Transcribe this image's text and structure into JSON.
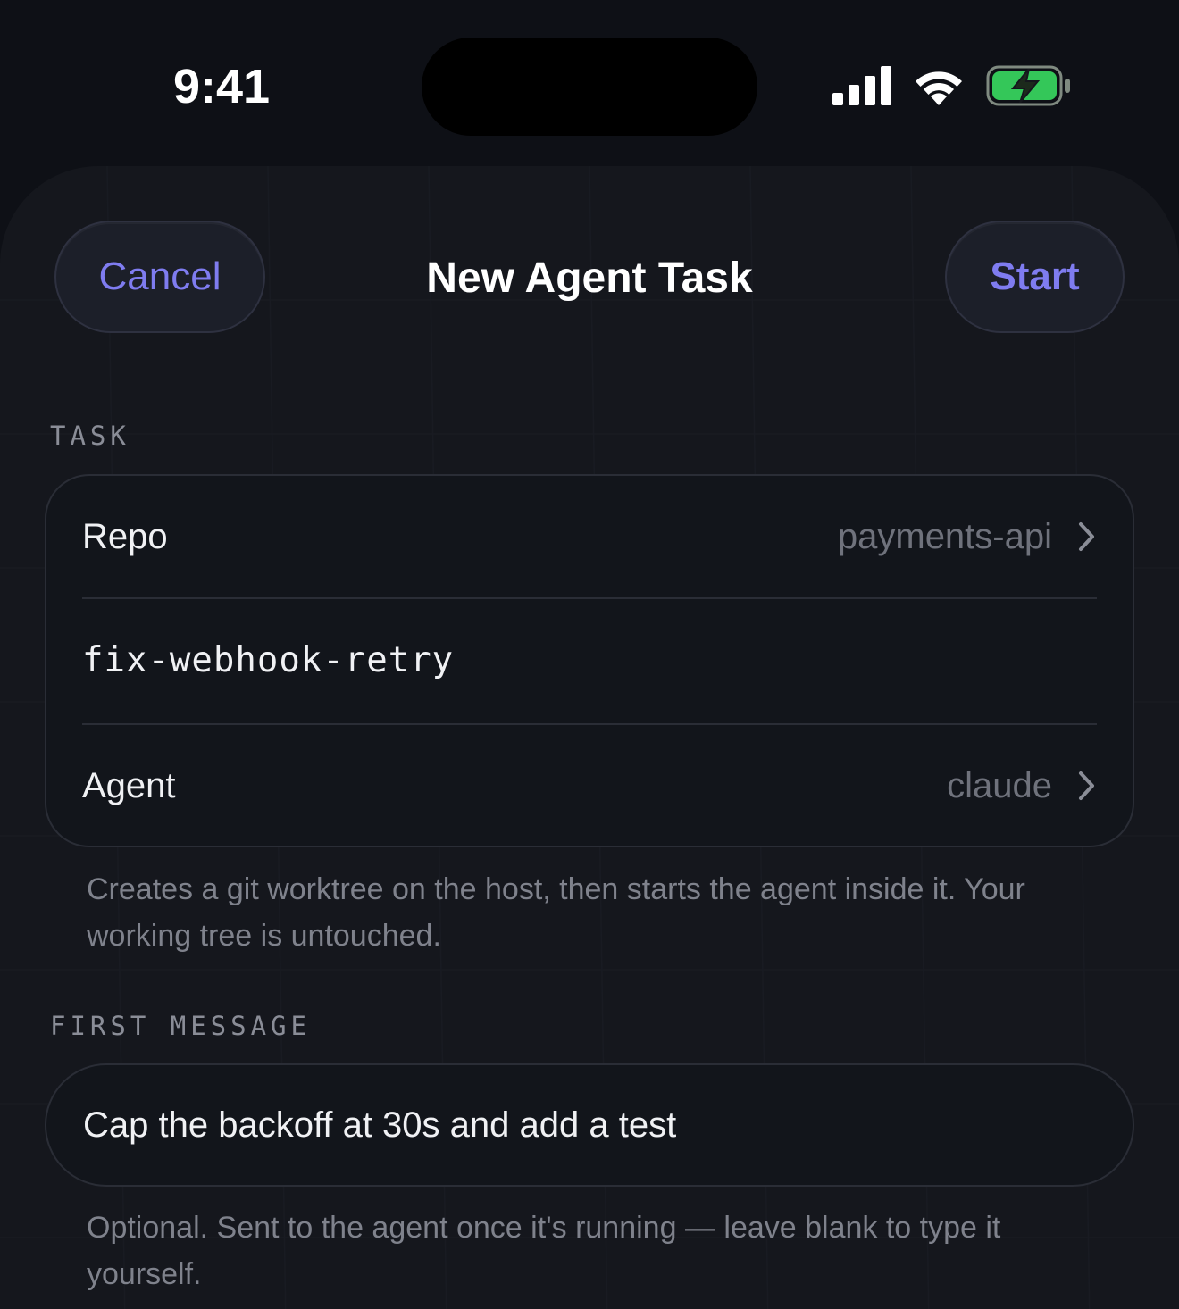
{
  "status_bar": {
    "time": "9:41",
    "icons": [
      "cellular-signal-icon",
      "wifi-icon",
      "battery-charging-icon"
    ],
    "battery_color": "#34c759"
  },
  "header": {
    "cancel_label": "Cancel",
    "title": "New Agent Task",
    "start_label": "Start"
  },
  "task_section": {
    "label": "TASK",
    "repo": {
      "label": "Repo",
      "value": "payments-api"
    },
    "branch_name": "fix-webhook-retry",
    "agent": {
      "label": "Agent",
      "value": "claude"
    },
    "hint": "Creates a git worktree on the host, then starts the agent inside it. Your working tree is untouched."
  },
  "message_section": {
    "label": "FIRST MESSAGE",
    "message": "Cap the backoff at 30s and add a test",
    "hint": "Optional. Sent to the agent once it's running — leave blank to type it yourself."
  },
  "colors": {
    "accent": "#7f7cf0",
    "background": "#0e1016",
    "sheet": "#15171d",
    "card": "#12151b"
  }
}
